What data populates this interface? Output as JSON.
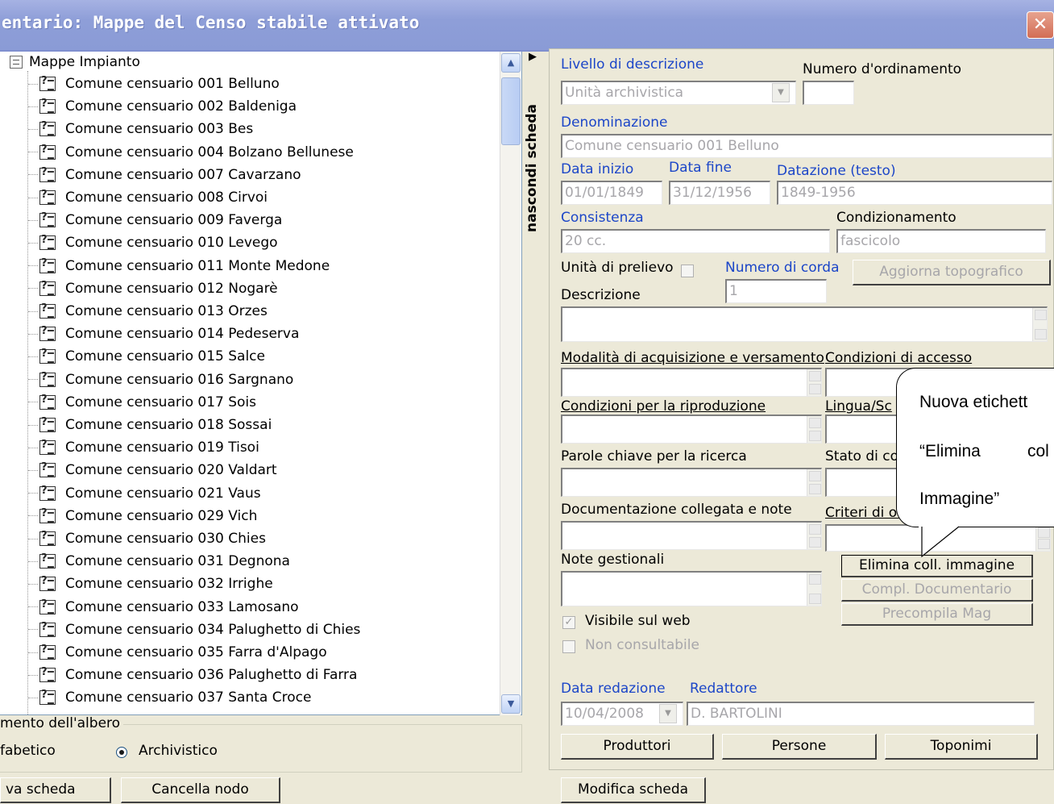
{
  "window": {
    "title": "entario: Mappe del Censo stabile attivato",
    "close_glyph": "✕"
  },
  "tree": {
    "root_label": "Mappe Impianto",
    "items": [
      "Comune censuario 001 Belluno",
      "Comune censuario 002 Baldeniga",
      "Comune censuario 003 Bes",
      "Comune censuario 004 Bolzano Bellunese",
      "Comune censuario 007 Cavarzano",
      "Comune censuario 008 Cirvoi",
      "Comune censuario 009 Faverga",
      "Comune censuario 010 Levego",
      "Comune censuario 011 Monte Medone",
      "Comune censuario 012 Nogarè",
      "Comune censuario 013 Orzes",
      "Comune censuario 014 Pedeserva",
      "Comune censuario 015 Salce",
      "Comune censuario 016 Sargnano",
      "Comune censuario 017 Sois",
      "Comune censuario 018 Sossai",
      "Comune censuario 019 Tisoi",
      "Comune censuario 020 Valdart",
      "Comune censuario 021 Vaus",
      "Comune censuario 029 Vich",
      "Comune censuario 030 Chies",
      "Comune censuario 031 Degnona",
      "Comune censuario 032 Irrighe",
      "Comune censuario 033 Lamosano",
      "Comune censuario 034 Palughetto di Chies",
      "Comune censuario 035 Farra d'Alpago",
      "Comune censuario 036 Palughetto di Farra",
      "Comune censuario 037 Santa Croce"
    ]
  },
  "ordinamento": {
    "legend": "mento dell'albero",
    "option_alfabetico": "fabetico",
    "option_archivistico": "Archivistico",
    "selected": "Archivistico"
  },
  "left_buttons": {
    "nuova": "va scheda",
    "cancella": "Cancella nodo"
  },
  "side_toggle": {
    "label": "nascondi scheda",
    "arrow": "▶"
  },
  "form": {
    "livello_label": "Livello di descrizione",
    "livello_value": "Unità archivistica",
    "numero_ord_label": "Numero d'ordinamento",
    "numero_ord_value": "",
    "denominazione_label": "Denominazione",
    "denominazione_value": "Comune censuario 001 Belluno",
    "data_inizio_label": "Data inizio",
    "data_inizio_value": "01/01/1849",
    "data_fine_label": "Data fine",
    "data_fine_value": "31/12/1956",
    "datazione_label": "Datazione (testo)",
    "datazione_value": "1849-1956",
    "consistenza_label": "Consistenza",
    "consistenza_value": "20 cc.",
    "condizionamento_label": "Condizionamento",
    "condizionamento_value": "fascicolo",
    "unita_prelievo_label": "Unità di prelievo",
    "numero_corda_label": "Numero di corda",
    "numero_corda_value": "1",
    "aggiorna_label": "Aggiorna topografico",
    "descrizione_label": "Descrizione",
    "modalita_label": "Modalità di acquisizione e versamento",
    "condizioni_accesso_label": "Condizioni di accesso",
    "condizioni_riproduzione_label": "Condizioni per la riproduzione",
    "lingua_label": "Lingua/Sc",
    "parole_chiave_label": "Parole chiave per la ricerca",
    "stato_label": "Stato di co",
    "documentazione_label": "Documentazione collegata e note",
    "criteri_label": "Criteri di ord",
    "note_gestionali_label": "Note gestionali",
    "elimina_label": "Elimina coll. immagine",
    "compl_label": "Compl. Documentario",
    "precompila_label": "Precompila Mag",
    "visibile_label": "Visibile sul web",
    "visibile_checked": true,
    "non_consultabile_label": "Non consultabile",
    "data_redazione_label": "Data redazione",
    "data_redazione_value": "10/04/2008",
    "redattore_label": "Redattore",
    "redattore_value": "D. BARTOLINI",
    "produttori_label": "Produttori",
    "persone_label": "Persone",
    "toponimi_label": "Toponimi"
  },
  "bottom_buttons": {
    "modifica": "Modifica scheda"
  },
  "callout": {
    "line1": "Nuova etichett",
    "line2a": "“Elimina",
    "line2b": "col",
    "line3": "Immagine”"
  }
}
